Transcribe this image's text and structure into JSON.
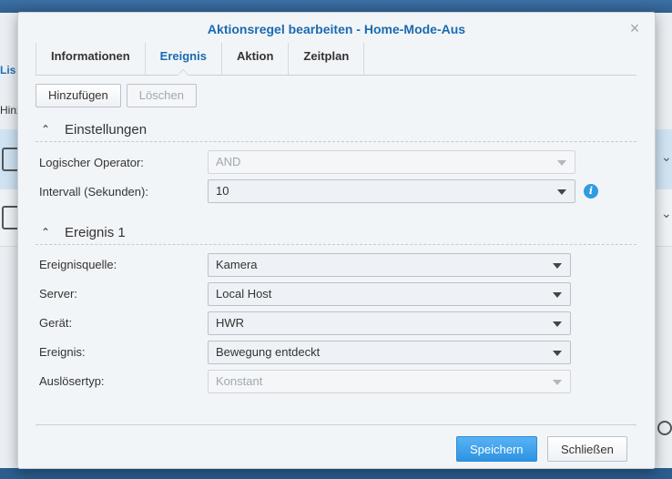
{
  "background": {
    "tab_fragment": "Lis",
    "button_fragment": "Hinz"
  },
  "dialog": {
    "title": "Aktionsregel bearbeiten - Home-Mode-Aus"
  },
  "tabs": [
    {
      "label": "Informationen",
      "active": false
    },
    {
      "label": "Ereignis",
      "active": true
    },
    {
      "label": "Aktion",
      "active": false
    },
    {
      "label": "Zeitplan",
      "active": false
    }
  ],
  "toolbar": {
    "add_label": "Hinzufügen",
    "delete_label": "Löschen"
  },
  "settings": {
    "title": "Einstellungen",
    "logical_operator_label": "Logischer Operator:",
    "logical_operator_value": "AND",
    "interval_label": "Intervall (Sekunden):",
    "interval_value": "10"
  },
  "event1": {
    "title": "Ereignis 1",
    "source_label": "Ereignisquelle:",
    "source_value": "Kamera",
    "server_label": "Server:",
    "server_value": "Local Host",
    "device_label": "Gerät:",
    "device_value": "HWR",
    "event_label": "Ereignis:",
    "event_value": "Bewegung entdeckt",
    "trigger_label": "Auslösertyp:",
    "trigger_value": "Konstant"
  },
  "footer": {
    "save_label": "Speichern",
    "close_label": "Schließen"
  },
  "colors": {
    "accent": "#1a6ab1",
    "primary_button": "#2d93e2",
    "info_icon": "#2f9be0"
  }
}
